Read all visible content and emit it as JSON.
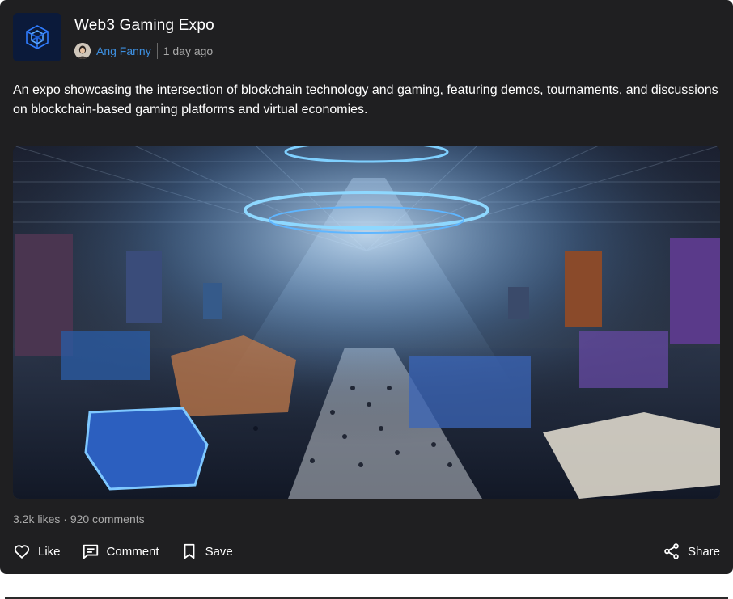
{
  "post": {
    "title": "Web3 Gaming Expo",
    "author": "Ang Fanny",
    "time_ago": "1 day ago",
    "description": "An expo showcasing the intersection of blockchain technology and gaming, featuring demos, tournaments, and discussions on blockchain-based gaming platforms and virtual economies."
  },
  "stats": {
    "likes": "3.2k likes",
    "separator": "·",
    "comments": "920 comments"
  },
  "actions": {
    "like": "Like",
    "comment": "Comment",
    "save": "Save",
    "share": "Share"
  },
  "icons": {
    "logo": "blockchain-cube-icon",
    "like": "heart-icon",
    "comment": "comment-icon",
    "save": "bookmark-icon",
    "share": "share-icon"
  },
  "colors": {
    "card_bg": "#1f1f21",
    "author_link": "#3d8fe0",
    "muted_text": "#a8a8a8"
  }
}
